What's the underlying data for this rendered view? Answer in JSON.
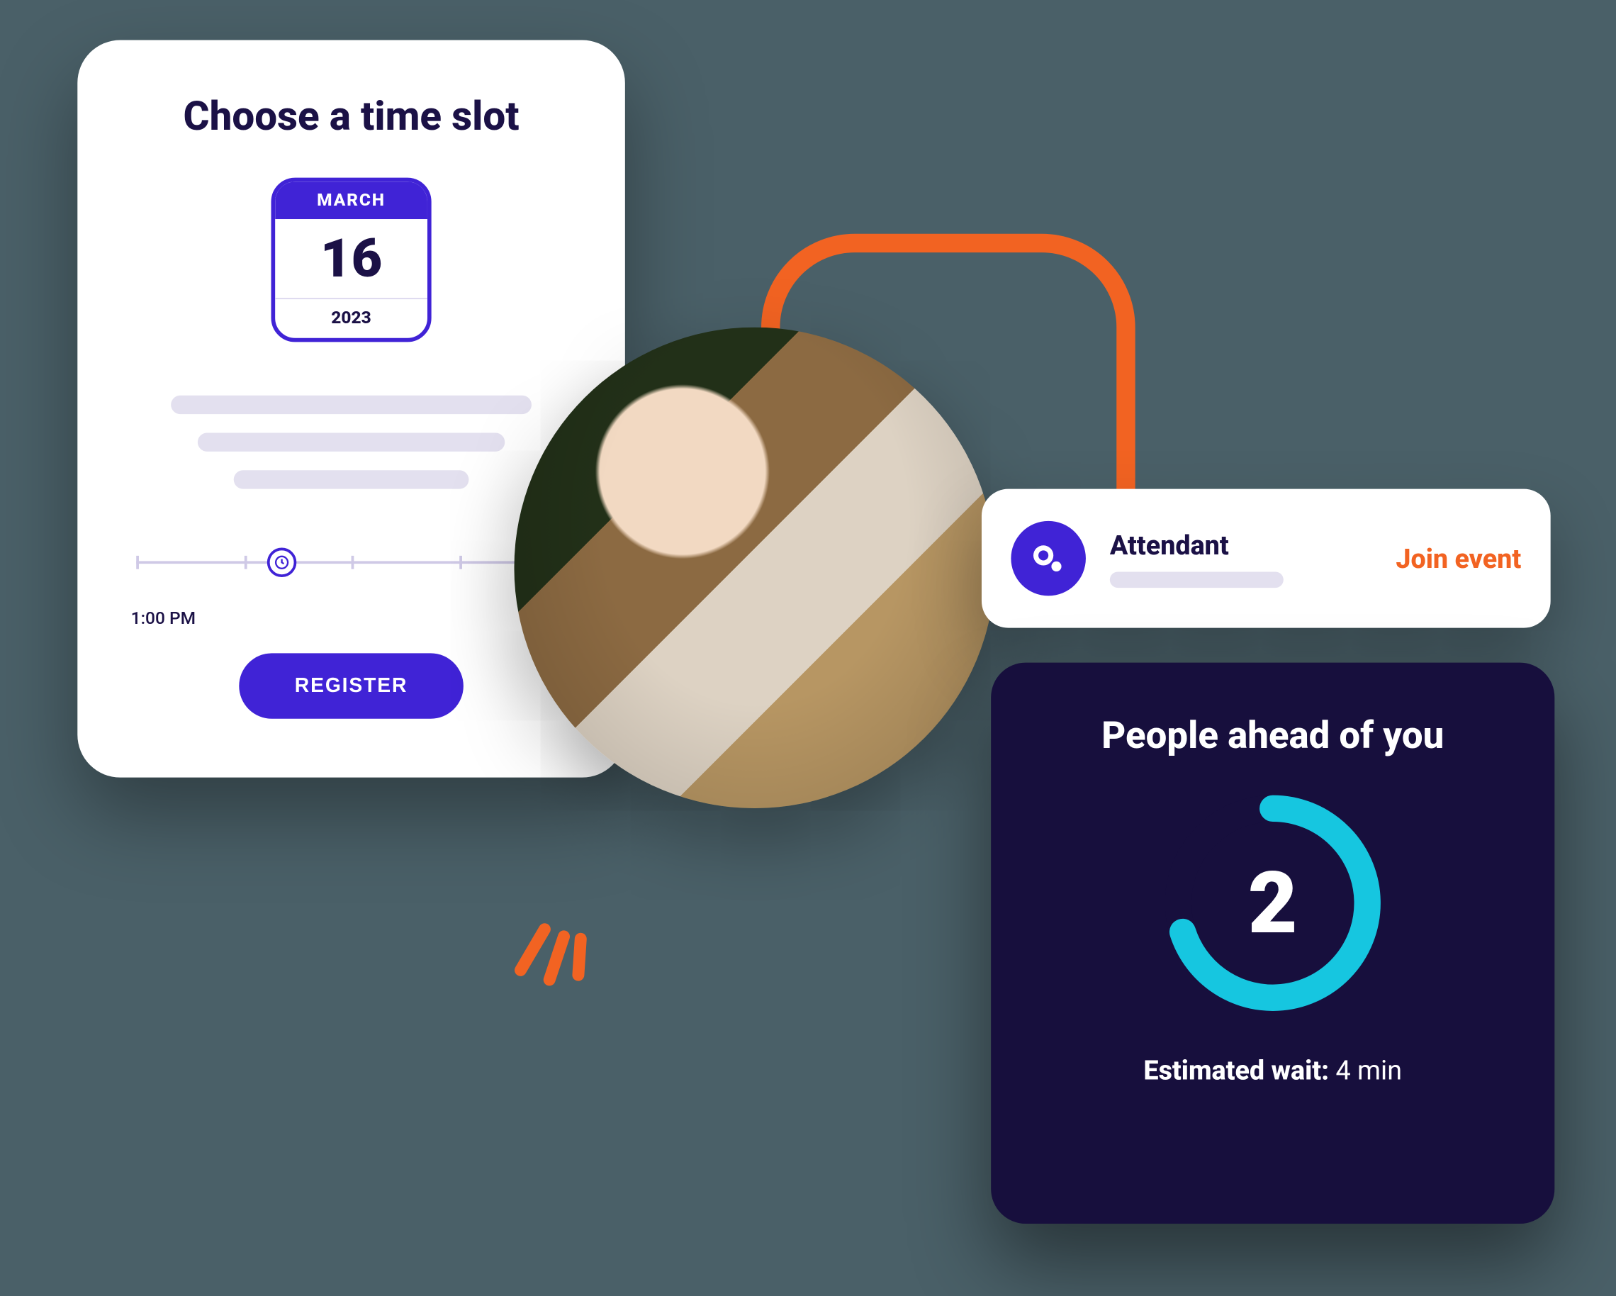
{
  "colors": {
    "accent_purple": "#4023d6",
    "dark_navy": "#170f3d",
    "orange": "#f26322",
    "cyan": "#16c6e0"
  },
  "timeslot_card": {
    "title": "Choose a time slot",
    "calendar": {
      "month": "MARCH",
      "day": "16",
      "year": "2023"
    },
    "timeline_label": "1:00 PM",
    "register_label": "REGISTER"
  },
  "attendant_bar": {
    "title": "Attendant",
    "join_label": "Join event"
  },
  "queue_card": {
    "title": "People ahead of you",
    "count": "2",
    "wait_label": "Estimated wait:",
    "wait_value": "4 min"
  }
}
